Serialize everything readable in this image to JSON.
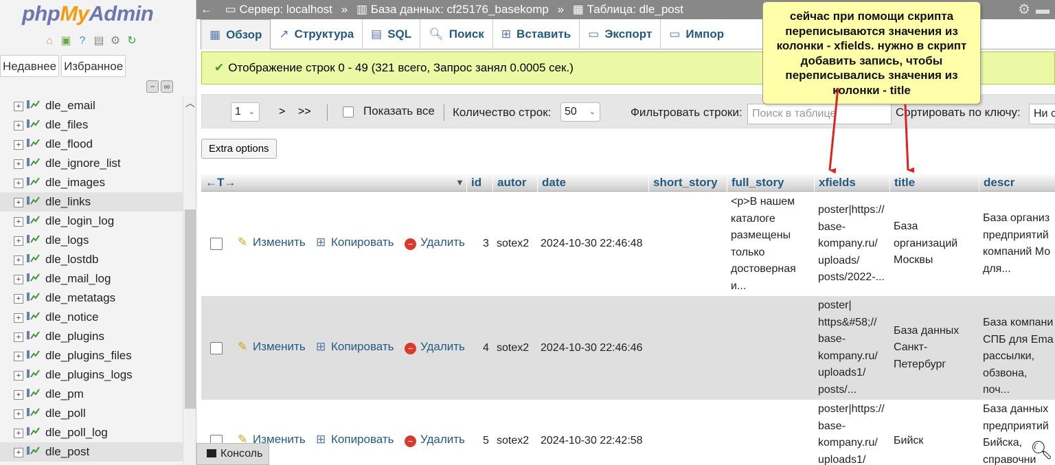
{
  "logo": {
    "php": "php",
    "my": "My",
    "admin": "Admin"
  },
  "left_tabs": [
    "Недавнее",
    "Избранное"
  ],
  "tree_items": [
    "dle_email",
    "dle_files",
    "dle_flood",
    "dle_ignore_list",
    "dle_images",
    "dle_links",
    "dle_login_log",
    "dle_logs",
    "dle_lostdb",
    "dle_mail_log",
    "dle_metatags",
    "dle_notice",
    "dle_plugins",
    "dle_plugins_files",
    "dle_plugins_logs",
    "dle_pm",
    "dle_poll",
    "dle_poll_log",
    "dle_post"
  ],
  "breadcrumb": {
    "server": "Сервер: localhost",
    "database": "База данных: cf25176_basekomp",
    "table": "Таблица: dle_post",
    "separator": "»"
  },
  "tabs": [
    "Обзор",
    "Структура",
    "SQL",
    "Поиск",
    "Вставить",
    "Экспорт",
    "Импор"
  ],
  "success_message": "Отображение строк 0 - 49 (321 всего, Запрос занял 0.0005 сек.)",
  "nav": {
    "page_value": "1",
    "next_label": ">",
    "last_label": ">>",
    "show_all_label": "Показать все",
    "rows_count_label": "Количество строк:",
    "rows_count_value": "50",
    "filter_label": "Фильтровать строки:",
    "filter_placeholder": "Поиск в таблице",
    "sort_label": "Сортировать по ключу:",
    "sort_value": "Ни с"
  },
  "extra_options_label": "Extra options",
  "table": {
    "arrows_label": "←T→",
    "columns": [
      "id",
      "autor",
      "date",
      "short_story",
      "full_story",
      "xfields",
      "title",
      "descr"
    ],
    "action_labels": {
      "edit": "Изменить",
      "copy": "Копировать",
      "delete": "Удалить"
    },
    "rows": [
      {
        "id": "3",
        "autor": "sotex2",
        "date": "2024-10-30 22:46:48",
        "short_story": "",
        "full_story": "<p>В нашем\nкаталоге\nразмещены\nтолько\nдостоверная\nи...",
        "xfields": "poster|https://\nbase-\nkompany.ru/\nuploads/\nposts/2022-...",
        "title": "База\nорганизаций\nМосквы",
        "descr": "База организ\nпредприятий\nкомпаний Мо\nдля..."
      },
      {
        "id": "4",
        "autor": "sotex2",
        "date": "2024-10-30 22:46:46",
        "short_story": "",
        "full_story": "",
        "xfields": "poster|\nhttps&#58;//\nbase-\nkompany.ru/\nuploads1/\nposts/...",
        "title": "База данных\nСанкт-\nПетербург",
        "descr": "База компани\nСПБ для Ema\nрассылки,\nобзвона, поч..."
      },
      {
        "id": "5",
        "autor": "sotex2",
        "date": "2024-10-30 22:42:58",
        "short_story": "",
        "full_story": "",
        "xfields": "poster|https://\nbase-\nkompany.ru/\nuploads1/",
        "title": "Бийск",
        "descr": "База данных\nпредприятий\nБийска,\nсправочни"
      }
    ]
  },
  "console_label": "Консоль",
  "annotation": "сейчас при помощи скрипта переписываются значения из колонки - xfields. нужно в скрипт добавить запись, чтобы переписывались значения из колонки - title",
  "colors": {
    "link": "#235a81",
    "success_bg": "#ebf8a4",
    "callout_bg": "#ffffa9",
    "arrow": "#e0201c",
    "topbar": "#888888"
  },
  "icons": [
    "home-icon",
    "exit-icon",
    "help-icon",
    "docs-icon",
    "gear-icon",
    "reload-icon",
    "table-icon",
    "edit-icon",
    "copy-icon",
    "delete-icon",
    "check-icon",
    "console-icon",
    "zoom-icon"
  ]
}
